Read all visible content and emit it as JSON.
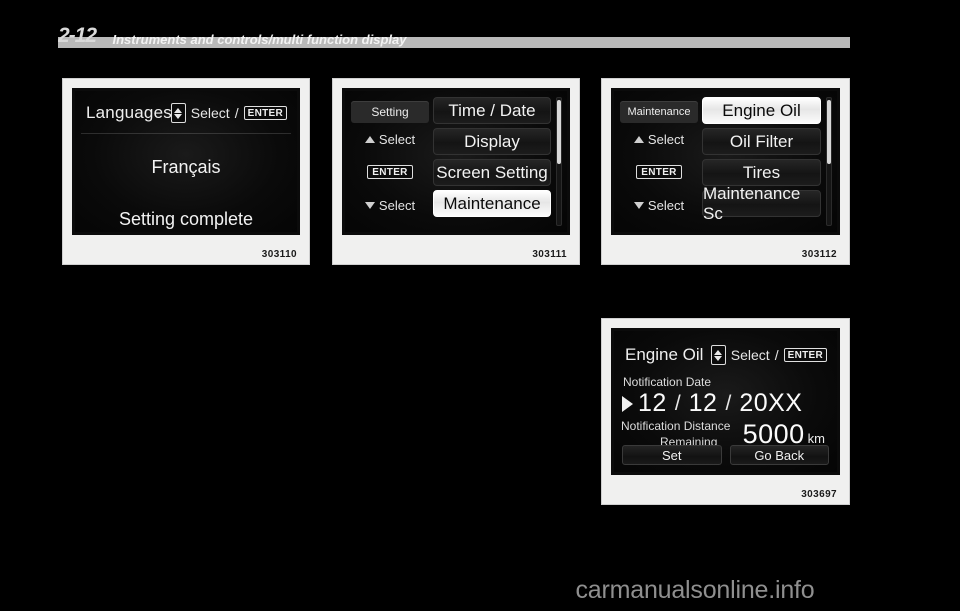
{
  "header": {
    "page_number": "2-12",
    "title": "Instruments and controls/multi function display"
  },
  "figures": [
    {
      "id": "303110",
      "screen": {
        "title": "Languages",
        "hint_select": "Select",
        "hint_slash": "/",
        "hint_enter": "ENTER",
        "value": "Français",
        "status": "Setting complete"
      }
    },
    {
      "id": "303111",
      "screen": {
        "tab_label": "Setting",
        "up_select": "Select",
        "enter": "ENTER",
        "down_select": "Select",
        "items": [
          {
            "label": "Time / Date",
            "selected": false
          },
          {
            "label": "Display",
            "selected": false
          },
          {
            "label": "Screen Setting",
            "selected": false
          },
          {
            "label": "Maintenance",
            "selected": true
          }
        ]
      }
    },
    {
      "id": "303112",
      "screen": {
        "tab_label": "Maintenance",
        "up_select": "Select",
        "enter": "ENTER",
        "down_select": "Select",
        "items": [
          {
            "label": "Engine Oil",
            "selected": true
          },
          {
            "label": "Oil Filter",
            "selected": false
          },
          {
            "label": "Tires",
            "selected": false
          },
          {
            "label": "Maintenance Sc",
            "selected": false
          }
        ]
      }
    },
    {
      "id": "303697",
      "screen": {
        "title": "Engine Oil",
        "hint_select": "Select",
        "hint_slash": "/",
        "hint_enter": "ENTER",
        "notification_date_label": "Notification Date",
        "date_month": "12",
        "date_day": "12",
        "date_year": "20XX",
        "date_sep_1": "/",
        "date_sep_2": "/",
        "notification_distance_label": "Notification Distance",
        "remaining_label": "Remaining",
        "distance_value": "5000",
        "distance_unit": "km",
        "button_set": "Set",
        "button_go_back": "Go Back"
      }
    }
  ],
  "footer": {
    "watermark": "carmanualsonline.info"
  }
}
